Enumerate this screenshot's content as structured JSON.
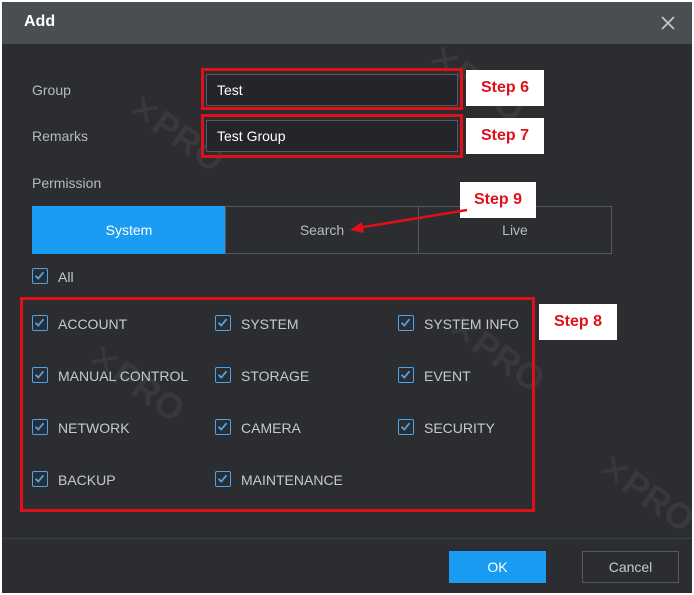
{
  "dialog": {
    "title": "Add"
  },
  "form": {
    "group_label": "Group",
    "group_value": "Test",
    "remarks_label": "Remarks",
    "remarks_value": "Test Group",
    "permission_label": "Permission"
  },
  "tabs": [
    {
      "label": "System",
      "active": true
    },
    {
      "label": "Search",
      "active": false
    },
    {
      "label": "Live",
      "active": false
    }
  ],
  "all_label": "All",
  "permissions": [
    "ACCOUNT",
    "SYSTEM",
    "SYSTEM INFO",
    "MANUAL CONTROL",
    "STORAGE",
    "EVENT",
    "NETWORK",
    "CAMERA",
    "SECURITY",
    "BACKUP",
    "MAINTENANCE"
  ],
  "steps": {
    "s6": "Step 6",
    "s7": "Step 7",
    "s8": "Step 8",
    "s9": "Step 9"
  },
  "buttons": {
    "ok": "OK",
    "cancel": "Cancel"
  },
  "colors": {
    "accent": "#1a9cf2",
    "highlight": "#e0101a",
    "background": "#2b2d31"
  }
}
